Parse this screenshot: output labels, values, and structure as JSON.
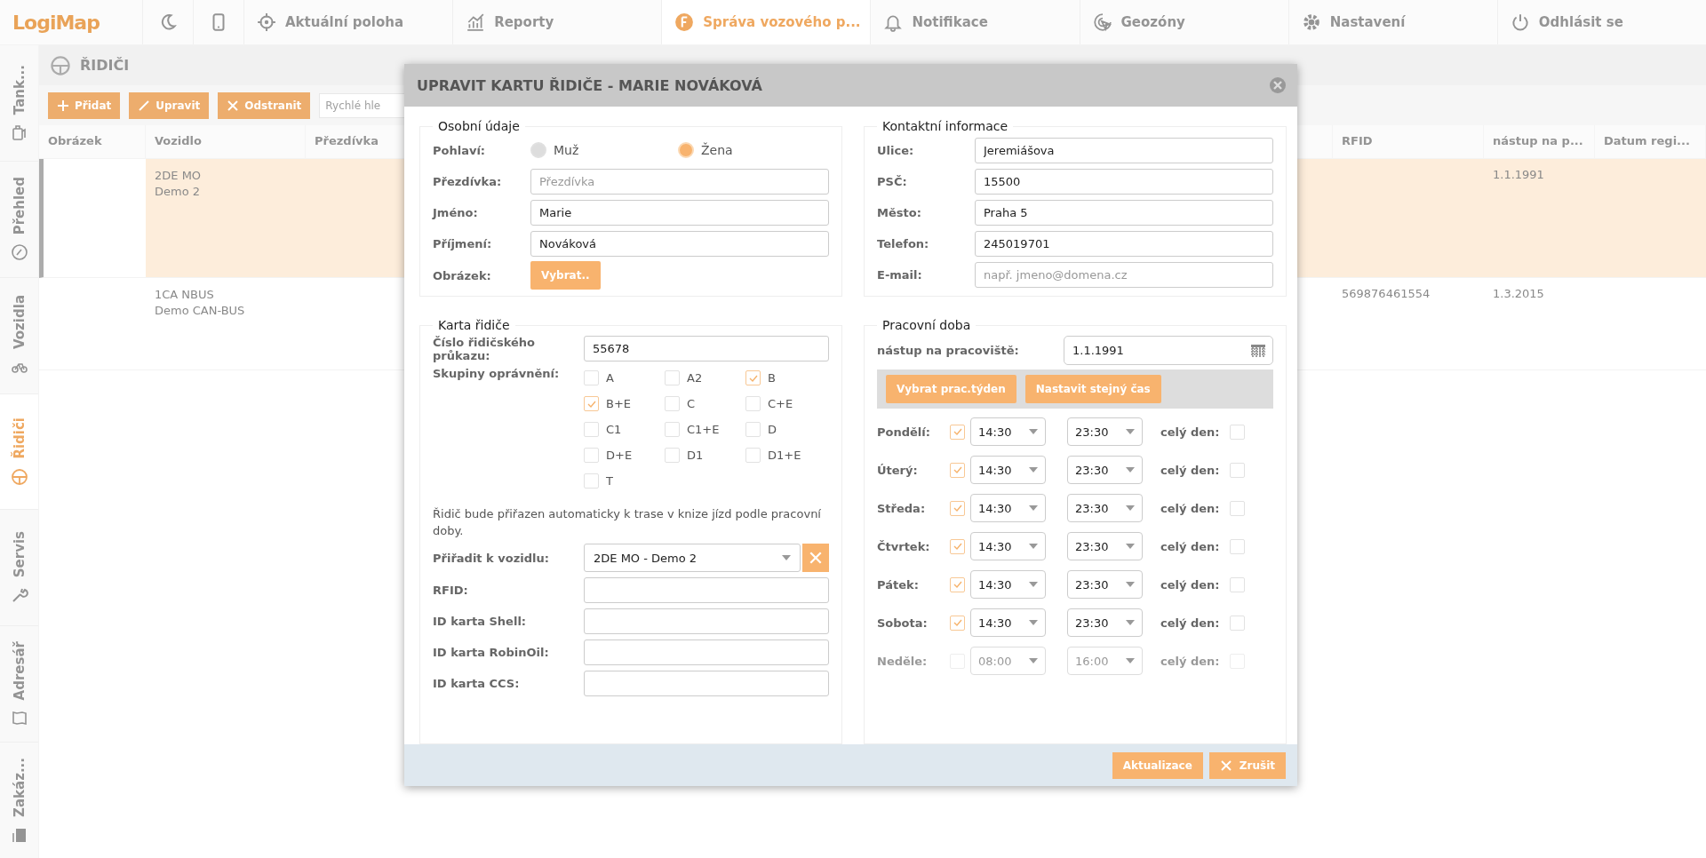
{
  "nav": {
    "logo": "LogiMap",
    "items": [
      {
        "kind": "icon",
        "selected": false
      },
      {
        "kind": "icon",
        "selected": false
      },
      {
        "kind": "text",
        "label": "Aktuální poloha",
        "selected": false
      },
      {
        "kind": "text",
        "label": "Reporty",
        "selected": false
      },
      {
        "kind": "text",
        "label": "Správa vozového p...",
        "selected": true
      },
      {
        "kind": "text",
        "label": "Notifikace",
        "selected": false
      },
      {
        "kind": "text",
        "label": "Geozóny",
        "selected": false
      },
      {
        "kind": "text",
        "label": "Nastavení",
        "selected": false
      },
      {
        "kind": "text",
        "label": "Odhlásit se",
        "selected": false
      }
    ]
  },
  "sidebar": {
    "items": [
      {
        "label": "Tank...",
        "selected": false
      },
      {
        "label": "Přehled",
        "selected": false
      },
      {
        "label": "Vozidla",
        "selected": false
      },
      {
        "label": "Řidiči",
        "selected": true
      },
      {
        "label": "Servis",
        "selected": false
      },
      {
        "label": "Adresář",
        "selected": false
      },
      {
        "label": "Zakáz...",
        "selected": false
      }
    ]
  },
  "page": {
    "title": "ŘIDIČI",
    "toolbar": [
      "Přidat",
      "Upravit",
      "Odstranit"
    ],
    "search": {
      "placeholder": "Rychlé hle"
    }
  },
  "table": {
    "columns": [
      "Obrázek",
      "Vozidlo",
      "Přezdívka",
      "RFID",
      "nástup na p...",
      "Datum regi..."
    ],
    "rows": [
      {
        "selected": true,
        "vehicle": [
          "2DE MO",
          "Demo 2"
        ],
        "start": "1.1.1991"
      },
      {
        "selected": false,
        "vehicle": [
          "1CA NBUS",
          "Demo CAN-BUS"
        ],
        "rfid": "569876461554",
        "start": "1.3.2015"
      }
    ]
  },
  "dialog": {
    "title": "UPRAVIT KARTU ŘIDIČE - MARIE NOVÁKOVÁ",
    "personal": {
      "legend": "Osobní údaje",
      "gender_label": "Pohlaví:",
      "genders": [
        {
          "label": "Muž",
          "selected": false
        },
        {
          "label": "Žena",
          "selected": true
        }
      ],
      "fields": [
        {
          "label": "Přezdívka:",
          "placeholder": "Přezdívka"
        },
        {
          "label": "Jméno:",
          "value": "Marie"
        },
        {
          "label": "Příjmení:",
          "value": "Nováková"
        }
      ],
      "image_label": "Obrázek:",
      "image_button": "Vybrat.."
    },
    "contact": {
      "legend": "Kontaktní informace",
      "fields": [
        {
          "label": "Ulice:",
          "value": "Jeremiášova"
        },
        {
          "label": "PSČ:",
          "value": "15500"
        },
        {
          "label": "Město:",
          "value": "Praha 5"
        },
        {
          "label": "Telefon:",
          "value": "245019701"
        },
        {
          "label": "E-mail:",
          "placeholder": "např. jmeno@domena.cz"
        }
      ]
    },
    "card": {
      "legend": "Karta řidiče",
      "license_label": "Číslo řidičského průkazu:",
      "license_value": "55678",
      "groups_label": "Skupiny oprávnění:",
      "groups": [
        {
          "label": "A",
          "checked": false
        },
        {
          "label": "A2",
          "checked": false
        },
        {
          "label": "B",
          "checked": true
        },
        {
          "label": "B+E",
          "checked": true
        },
        {
          "label": "C",
          "checked": false
        },
        {
          "label": "C+E",
          "checked": false
        },
        {
          "label": "C1",
          "checked": false
        },
        {
          "label": "C1+E",
          "checked": false
        },
        {
          "label": "D",
          "checked": false
        },
        {
          "label": "D+E",
          "checked": false
        },
        {
          "label": "D1",
          "checked": false
        },
        {
          "label": "D1+E",
          "checked": false
        },
        {
          "label": "T",
          "checked": false
        }
      ],
      "note": "Řidič bude přiřazen automaticky k trase v knize jízd podle pracovní doby.",
      "vehicle_label": "Přiřadit k vozidlu:",
      "vehicle_value": "2DE MO - Demo 2",
      "fields": [
        {
          "label": "RFID:"
        },
        {
          "label": "ID karta Shell:"
        },
        {
          "label": "ID karta RobinOil:"
        },
        {
          "label": "ID karta CCS:"
        }
      ]
    },
    "work": {
      "legend": "Pracovní doba",
      "start_label": "nástup na pracoviště:",
      "start_value": "1.1.1991",
      "buttons": [
        "Vybrat prac.týden",
        "Nastavit stejný čas"
      ],
      "days": [
        {
          "label": "Pondělí:",
          "enabled": true,
          "from": "14:30",
          "to": "23:30",
          "allday_label": "celý den:",
          "allday": false
        },
        {
          "label": "Úterý:",
          "enabled": true,
          "from": "14:30",
          "to": "23:30",
          "allday_label": "celý den:",
          "allday": false
        },
        {
          "label": "Středa:",
          "enabled": true,
          "from": "14:30",
          "to": "23:30",
          "allday_label": "celý den:",
          "allday": false
        },
        {
          "label": "Čtvrtek:",
          "enabled": true,
          "from": "14:30",
          "to": "23:30",
          "allday_label": "celý den:",
          "allday": false
        },
        {
          "label": "Pátek:",
          "enabled": true,
          "from": "14:30",
          "to": "23:30",
          "allday_label": "celý den:",
          "allday": false
        },
        {
          "label": "Sobota:",
          "enabled": true,
          "from": "14:30",
          "to": "23:30",
          "allday_label": "celý den:",
          "allday": false
        },
        {
          "label": "Neděle:",
          "enabled": false,
          "from": "08:00",
          "to": "16:00",
          "allday_label": "celý den:",
          "allday": false
        }
      ]
    },
    "buttons": [
      "Aktualizace",
      "Zrušit"
    ]
  }
}
